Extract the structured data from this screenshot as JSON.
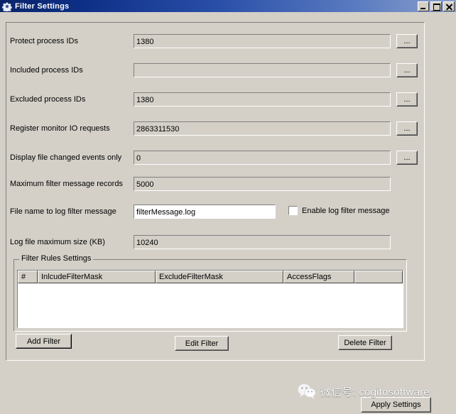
{
  "window": {
    "title": "Filter Settings",
    "icon": "gear-icon",
    "minimize_label": "Minimize",
    "maximize_label": "Maximize",
    "close_label": "Close",
    "titlebar_gradient_start": "#0a246a",
    "titlebar_gradient_end": "#8ba0cc",
    "face_color": "#d4d0c8"
  },
  "form": {
    "browse_label": "...",
    "fields": [
      {
        "label": "Protect process IDs",
        "value": "1380",
        "readonly": true,
        "has_browse": true
      },
      {
        "label": "Included process IDs",
        "value": "",
        "readonly": true,
        "has_browse": true
      },
      {
        "label": "Excluded process IDs",
        "value": "1380",
        "readonly": true,
        "has_browse": true
      },
      {
        "label": "Register monitor IO requests",
        "value": "2863311530",
        "readonly": true,
        "has_browse": true
      },
      {
        "label": "Display file changed events only",
        "value": "0",
        "readonly": true,
        "has_browse": true
      },
      {
        "label": "Maximum filter message records",
        "value": "5000",
        "readonly": true,
        "has_browse": false
      },
      {
        "label": "File name to log filter message",
        "value": "filterMessage.log",
        "readonly": false,
        "has_browse": false
      },
      {
        "label": "Log file maximum size (KB)",
        "value": "10240",
        "readonly": true,
        "has_browse": false
      }
    ],
    "enable_log_checkbox": {
      "label": "Enable log filter message",
      "checked": false
    }
  },
  "filter_rules": {
    "group_title": "Filter Rules Settings",
    "columns": [
      "#",
      "InlcudeFilterMask",
      "ExcludeFilterMask",
      "AccessFlags",
      ""
    ],
    "rows": [],
    "buttons": {
      "add": "Add Filter",
      "edit": "Edit Filter",
      "delete": "Delete Filter"
    }
  },
  "footer": {
    "apply_label": "Apply Settings"
  },
  "watermark": {
    "icon": "wechat-icon",
    "text": "微信号: cogitosoftware"
  }
}
